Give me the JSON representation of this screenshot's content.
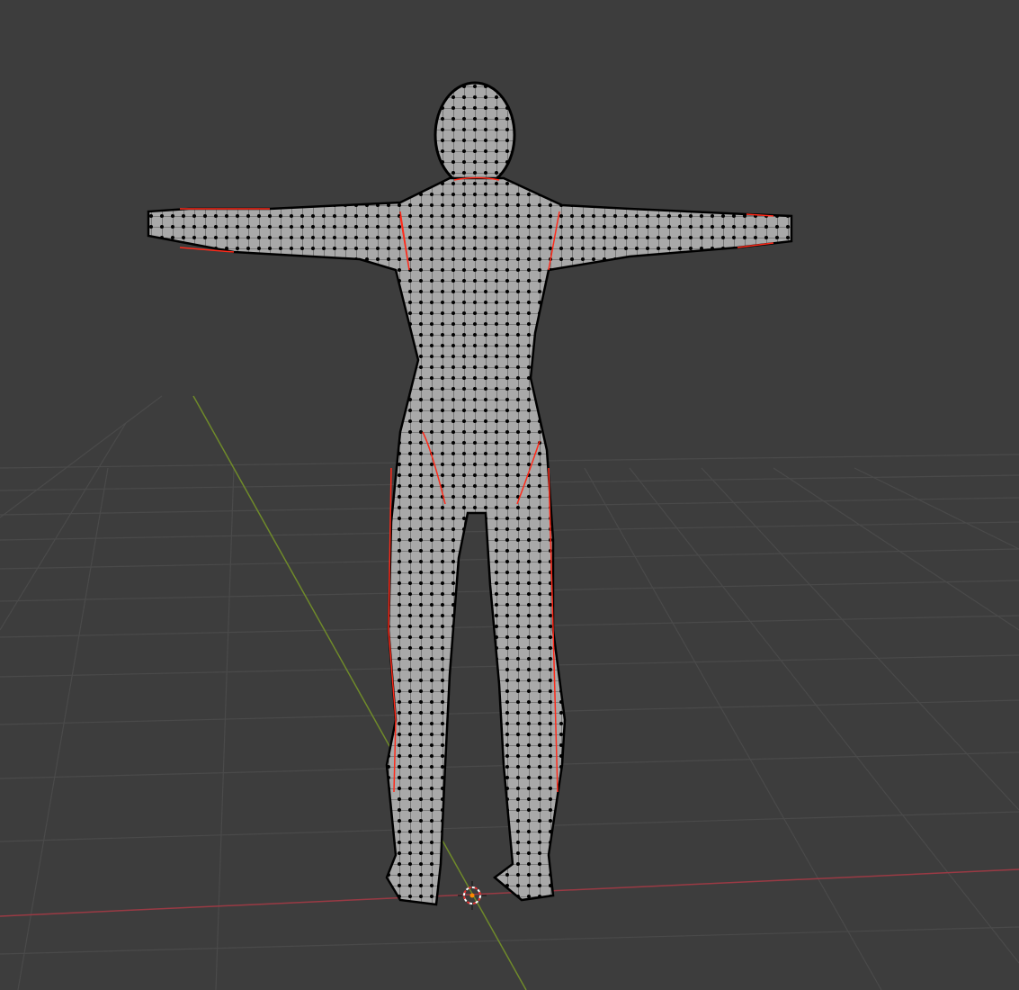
{
  "viewport": {
    "mode": "edit-mode",
    "background_color": "#3d3d3d",
    "grid_color": "#4a4a4a",
    "x_axis_color": "#9a3a44",
    "y_axis_color": "#6f8a2a",
    "mesh_color": "#a9a9a9",
    "vertex_color": "#000000",
    "seam_color": "#ff2a1a"
  },
  "icons": [
    "3d-cursor-icon"
  ]
}
